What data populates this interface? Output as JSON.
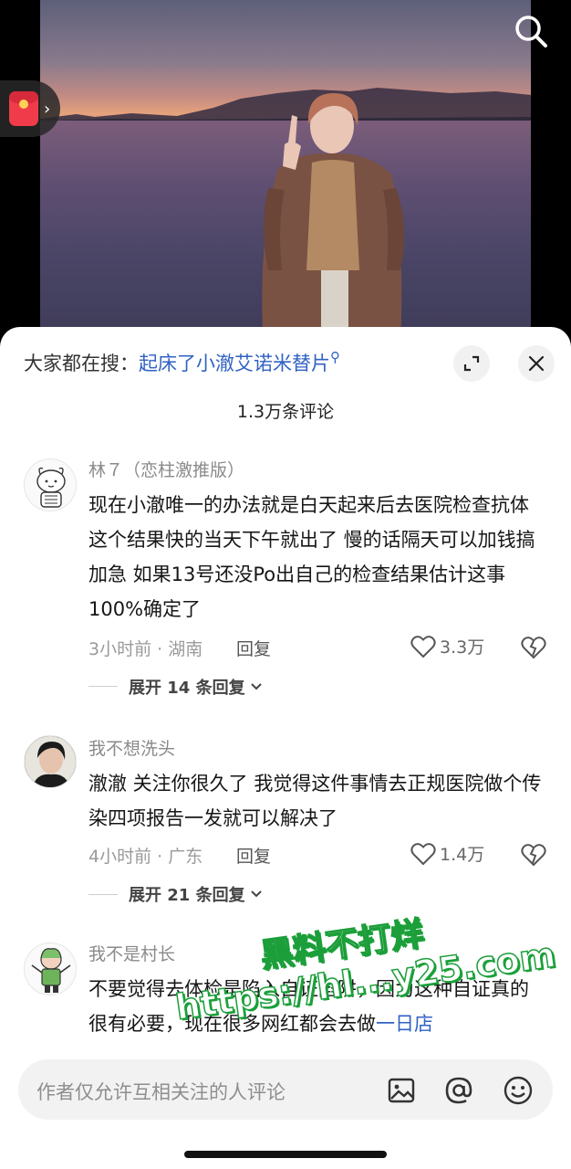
{
  "hot_search": {
    "prefix": "大家都在搜：",
    "query": "起床了小澈艾诺米替片"
  },
  "comment_count": "1.3万条评论",
  "comments": [
    {
      "username": "林７（恋柱激推版）",
      "text": "现在小澈唯一的办法就是白天起来后去医院检查抗体 这个结果快的当天下午就出了 慢的话隔天可以加钱搞加急 如果13号还没Po出自己的检查结果估计这事100%确定了",
      "time_location": "3小时前 · 湖南",
      "reply_label": "回复",
      "likes": "3.3万",
      "expand_label": "展开 14 条回复"
    },
    {
      "username": "我不想洗头",
      "text": "澈澈 关注你很久了 我觉得这件事情去正规医院做个传染四项报告一发就可以解决了",
      "time_location": "4小时前 · 广东",
      "reply_label": "回复",
      "likes": "1.4万",
      "expand_label": "展开 21 条回复"
    },
    {
      "username": "我不是村长",
      "text_part1": "不要觉得去体检是陷入自证陷阱，因为这种自证真的很有必要，现在很多网红都会去做",
      "text_link": "一日店"
    }
  ],
  "watermark": {
    "line1": "黑料不打烊",
    "line2": "https://hl...y25.com"
  },
  "input": {
    "placeholder": "作者仅允许互相关注的人评论"
  },
  "icons": {
    "top_search": "search-icon",
    "red_packet": "red-packet-icon",
    "expand": "expand-icon",
    "close": "close-icon",
    "like": "heart-icon",
    "dislike": "broken-heart-icon",
    "image": "image-icon",
    "at": "at-icon",
    "emoji": "emoji-icon"
  }
}
